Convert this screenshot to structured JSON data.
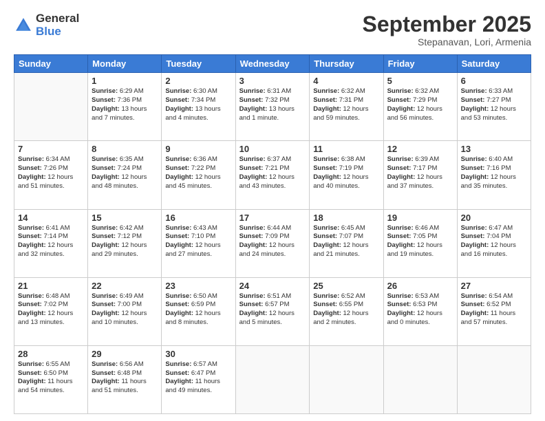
{
  "logo": {
    "general": "General",
    "blue": "Blue"
  },
  "header": {
    "month": "September 2025",
    "location": "Stepanavan, Lori, Armenia"
  },
  "weekdays": [
    "Sunday",
    "Monday",
    "Tuesday",
    "Wednesday",
    "Thursday",
    "Friday",
    "Saturday"
  ],
  "weeks": [
    [
      {
        "day": "",
        "sunrise": "",
        "sunset": "",
        "daylight": ""
      },
      {
        "day": "1",
        "sunrise": "6:29 AM",
        "sunset": "7:36 PM",
        "daylight": "13 hours and 7 minutes."
      },
      {
        "day": "2",
        "sunrise": "6:30 AM",
        "sunset": "7:34 PM",
        "daylight": "13 hours and 4 minutes."
      },
      {
        "day": "3",
        "sunrise": "6:31 AM",
        "sunset": "7:32 PM",
        "daylight": "13 hours and 1 minute."
      },
      {
        "day": "4",
        "sunrise": "6:32 AM",
        "sunset": "7:31 PM",
        "daylight": "12 hours and 59 minutes."
      },
      {
        "day": "5",
        "sunrise": "6:32 AM",
        "sunset": "7:29 PM",
        "daylight": "12 hours and 56 minutes."
      },
      {
        "day": "6",
        "sunrise": "6:33 AM",
        "sunset": "7:27 PM",
        "daylight": "12 hours and 53 minutes."
      }
    ],
    [
      {
        "day": "7",
        "sunrise": "6:34 AM",
        "sunset": "7:26 PM",
        "daylight": "12 hours and 51 minutes."
      },
      {
        "day": "8",
        "sunrise": "6:35 AM",
        "sunset": "7:24 PM",
        "daylight": "12 hours and 48 minutes."
      },
      {
        "day": "9",
        "sunrise": "6:36 AM",
        "sunset": "7:22 PM",
        "daylight": "12 hours and 45 minutes."
      },
      {
        "day": "10",
        "sunrise": "6:37 AM",
        "sunset": "7:21 PM",
        "daylight": "12 hours and 43 minutes."
      },
      {
        "day": "11",
        "sunrise": "6:38 AM",
        "sunset": "7:19 PM",
        "daylight": "12 hours and 40 minutes."
      },
      {
        "day": "12",
        "sunrise": "6:39 AM",
        "sunset": "7:17 PM",
        "daylight": "12 hours and 37 minutes."
      },
      {
        "day": "13",
        "sunrise": "6:40 AM",
        "sunset": "7:16 PM",
        "daylight": "12 hours and 35 minutes."
      }
    ],
    [
      {
        "day": "14",
        "sunrise": "6:41 AM",
        "sunset": "7:14 PM",
        "daylight": "12 hours and 32 minutes."
      },
      {
        "day": "15",
        "sunrise": "6:42 AM",
        "sunset": "7:12 PM",
        "daylight": "12 hours and 29 minutes."
      },
      {
        "day": "16",
        "sunrise": "6:43 AM",
        "sunset": "7:10 PM",
        "daylight": "12 hours and 27 minutes."
      },
      {
        "day": "17",
        "sunrise": "6:44 AM",
        "sunset": "7:09 PM",
        "daylight": "12 hours and 24 minutes."
      },
      {
        "day": "18",
        "sunrise": "6:45 AM",
        "sunset": "7:07 PM",
        "daylight": "12 hours and 21 minutes."
      },
      {
        "day": "19",
        "sunrise": "6:46 AM",
        "sunset": "7:05 PM",
        "daylight": "12 hours and 19 minutes."
      },
      {
        "day": "20",
        "sunrise": "6:47 AM",
        "sunset": "7:04 PM",
        "daylight": "12 hours and 16 minutes."
      }
    ],
    [
      {
        "day": "21",
        "sunrise": "6:48 AM",
        "sunset": "7:02 PM",
        "daylight": "12 hours and 13 minutes."
      },
      {
        "day": "22",
        "sunrise": "6:49 AM",
        "sunset": "7:00 PM",
        "daylight": "12 hours and 10 minutes."
      },
      {
        "day": "23",
        "sunrise": "6:50 AM",
        "sunset": "6:59 PM",
        "daylight": "12 hours and 8 minutes."
      },
      {
        "day": "24",
        "sunrise": "6:51 AM",
        "sunset": "6:57 PM",
        "daylight": "12 hours and 5 minutes."
      },
      {
        "day": "25",
        "sunrise": "6:52 AM",
        "sunset": "6:55 PM",
        "daylight": "12 hours and 2 minutes."
      },
      {
        "day": "26",
        "sunrise": "6:53 AM",
        "sunset": "6:53 PM",
        "daylight": "12 hours and 0 minutes."
      },
      {
        "day": "27",
        "sunrise": "6:54 AM",
        "sunset": "6:52 PM",
        "daylight": "11 hours and 57 minutes."
      }
    ],
    [
      {
        "day": "28",
        "sunrise": "6:55 AM",
        "sunset": "6:50 PM",
        "daylight": "11 hours and 54 minutes."
      },
      {
        "day": "29",
        "sunrise": "6:56 AM",
        "sunset": "6:48 PM",
        "daylight": "11 hours and 51 minutes."
      },
      {
        "day": "30",
        "sunrise": "6:57 AM",
        "sunset": "6:47 PM",
        "daylight": "11 hours and 49 minutes."
      },
      {
        "day": "",
        "sunrise": "",
        "sunset": "",
        "daylight": ""
      },
      {
        "day": "",
        "sunrise": "",
        "sunset": "",
        "daylight": ""
      },
      {
        "day": "",
        "sunrise": "",
        "sunset": "",
        "daylight": ""
      },
      {
        "day": "",
        "sunrise": "",
        "sunset": "",
        "daylight": ""
      }
    ]
  ]
}
